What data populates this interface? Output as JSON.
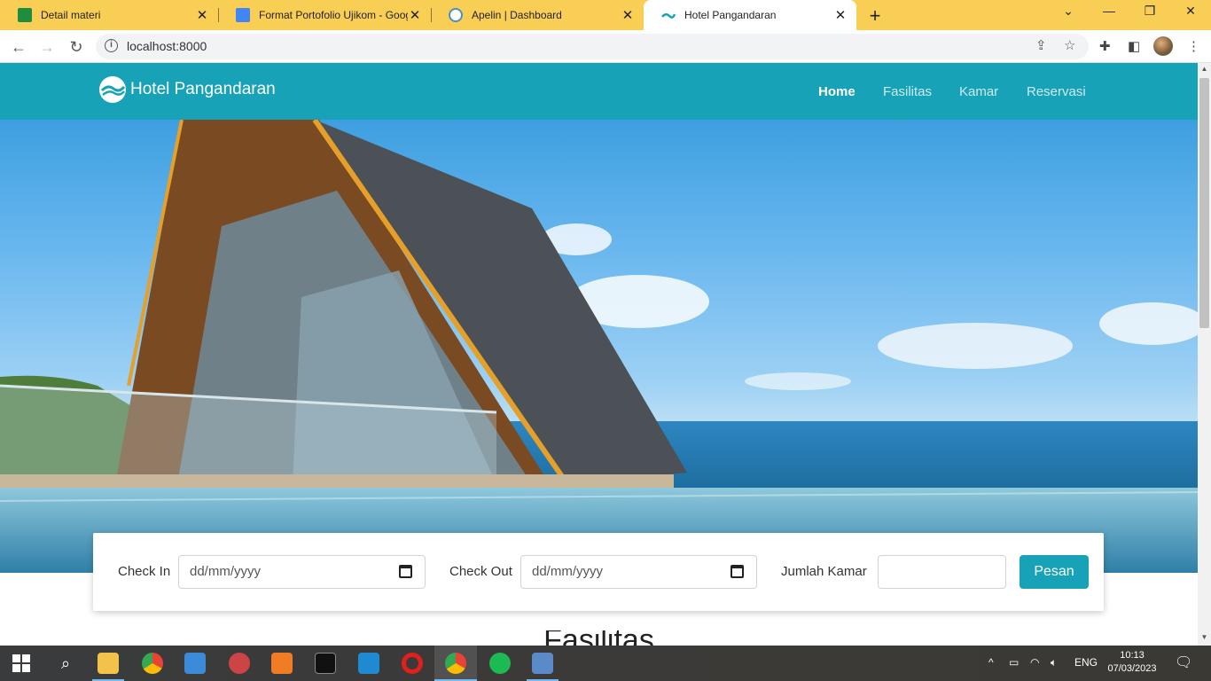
{
  "browser": {
    "tabs": [
      {
        "title": "Detail materi",
        "icon": "classroom-icon",
        "color": "#1e8e3e"
      },
      {
        "title": "Format Portofolio Ujikom - Goog",
        "icon": "docs-icon",
        "color": "#4285f4"
      },
      {
        "title": "Apelin | Dashboard",
        "icon": "apelin-icon",
        "color": "#4a90c8"
      },
      {
        "title": "Hotel Pangandaran",
        "icon": "wave-icon",
        "color": "#17a2b8"
      }
    ],
    "active_tab": 3,
    "address": "localhost:8000",
    "tab_close": "✕",
    "new_tab": "+"
  },
  "site": {
    "brand": "Hotel Pangandaran",
    "nav": [
      "Home",
      "Fasilitas",
      "Kamar",
      "Reservasi"
    ],
    "active_nav": "Home",
    "accent": "#17a2b8"
  },
  "booking": {
    "checkin_label": "Check In",
    "checkin_placeholder": "dd/mm/yyyy",
    "checkout_label": "Check Out",
    "checkout_placeholder": "dd/mm/yyyy",
    "rooms_label": "Jumlah Kamar",
    "rooms_value": "",
    "submit_label": "Pesan"
  },
  "section": {
    "title": "Fasilitas"
  },
  "taskbar": {
    "apps": [
      "windows-start-icon",
      "search-icon",
      "file-explorer-icon",
      "chrome-icon",
      "photos-icon",
      "app-icon",
      "xampp-icon",
      "terminal-icon",
      "vscode-icon",
      "opera-icon",
      "chrome-profile-icon",
      "spotify-icon",
      "remote-desktop-icon"
    ],
    "language": "ENG",
    "time": "10:13",
    "date": "07/03/2023"
  }
}
